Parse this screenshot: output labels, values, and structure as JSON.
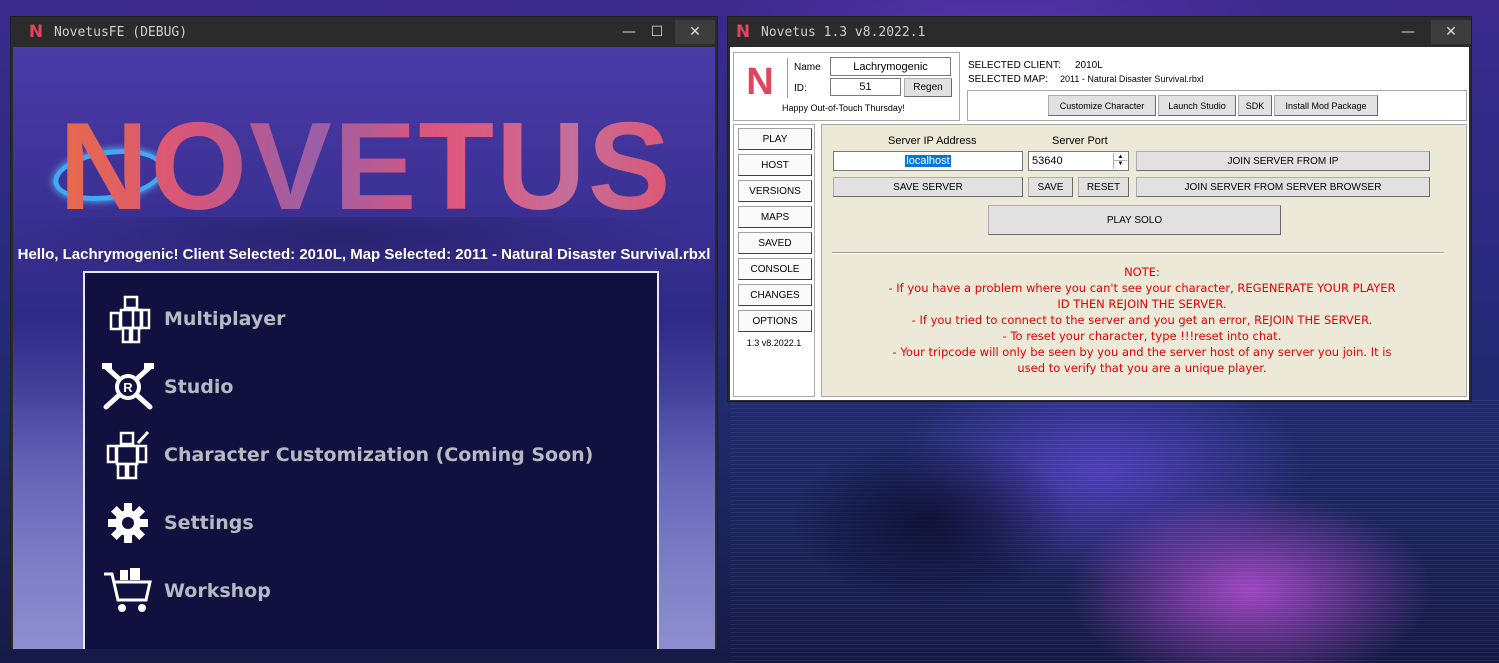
{
  "fe_window": {
    "title": "NovetusFE (DEBUG)",
    "logo_glyph": "N",
    "controls": {
      "minimize": "—",
      "maximize": "☐",
      "close": "✕"
    },
    "logo_text": "NOVETUS",
    "greeting": "Hello, Lachrymogenic! Client Selected: 2010L, Map Selected: 2011 - Natural Disaster Survival.rbxl",
    "menu": [
      {
        "label": "Multiplayer",
        "icon": "multiplayer-icon"
      },
      {
        "label": "Studio",
        "icon": "studio-icon"
      },
      {
        "label": "Character Customization (Coming Soon)",
        "icon": "character-icon"
      },
      {
        "label": "Settings",
        "icon": "gear-icon"
      },
      {
        "label": "Workshop",
        "icon": "shopping-cart-icon"
      }
    ]
  },
  "launcher_window": {
    "title": "Novetus 1.3 v8.2022.1",
    "logo_glyph": "N",
    "controls": {
      "minimize": "—",
      "close": "✕"
    },
    "user": {
      "name_label": "Name",
      "name_value": "Lachrymogenic",
      "id_label": "ID:",
      "id_value": "51",
      "regen_label": "Regen",
      "day_message": "Happy Out-of-Touch Thursday!"
    },
    "selection": {
      "client_label": "SELECTED CLIENT:",
      "client_value": "2010L",
      "map_label": "SELECTED MAP:",
      "map_value": "2011 - Natural Disaster Survival.rbxl"
    },
    "top_buttons": {
      "customize": "Customize Character",
      "studio": "Launch Studio",
      "sdk": "SDK",
      "mod": "Install Mod Package"
    },
    "tabs": [
      "PLAY",
      "HOST",
      "VERSIONS",
      "MAPS",
      "SAVED",
      "CONSOLE",
      "CHANGES",
      "OPTIONS"
    ],
    "version": "1.3 v8.2022.1",
    "play": {
      "ip_label": "Server IP Address",
      "ip_value": "localhost",
      "port_label": "Server Port",
      "port_value": "53640",
      "join_ip": "JOIN SERVER FROM IP",
      "save_server": "SAVE SERVER",
      "save": "SAVE",
      "reset": "RESET",
      "join_browser": "JOIN SERVER FROM SERVER BROWSER",
      "play_solo": "PLAY SOLO",
      "note": [
        "NOTE:",
        "- If you have a problem where you can't see your character, REGENERATE YOUR PLAYER",
        "ID THEN REJOIN THE SERVER.",
        "- If you tried to connect to the server and you get an error, REJOIN THE SERVER.",
        "- To reset your character, type !!!reset into chat.",
        "- Your tripcode will only be seen by you and the server host of any server you join. It is",
        "used to verify that you are a unique player."
      ]
    },
    "colors": {
      "note_text": "#e60000",
      "selection_highlight": "#0078d7",
      "panel": "#ece9d8"
    }
  }
}
